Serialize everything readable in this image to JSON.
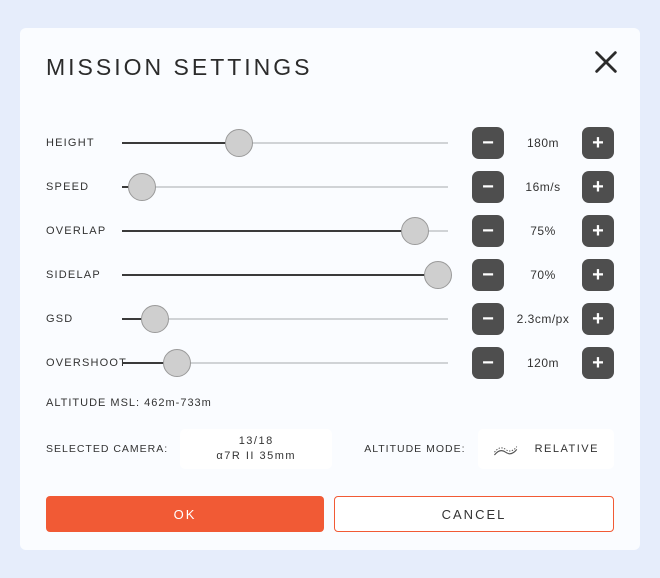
{
  "title": "MISSION  SETTINGS",
  "sliders": {
    "height": {
      "label": "HEIGHT",
      "value": "180m",
      "pos": 36
    },
    "speed": {
      "label": "SPEED",
      "value": "16m/s",
      "pos": 6
    },
    "overlap": {
      "label": "OVERLAP",
      "value": "75%",
      "pos": 90
    },
    "sidelap": {
      "label": "SIDELAP",
      "value": "70%",
      "pos": 97
    },
    "gsd": {
      "label": "GSD",
      "value": "2.3cm/px",
      "pos": 10
    },
    "overshoot": {
      "label": "OVERSHOOT",
      "value": "120m",
      "pos": 17
    }
  },
  "glyph": {
    "minus": "−",
    "plus": "+"
  },
  "altitude_msl": "ALTITUDE MSL: 462m-733m",
  "camera": {
    "label": "SELECTED CAMERA:",
    "line1": "13/18",
    "line2": "α7R II 35mm"
  },
  "altmode": {
    "label": "ALTITUDE MODE:",
    "value": "RELATIVE"
  },
  "buttons": {
    "ok": "OK",
    "cancel": "CANCEL"
  }
}
